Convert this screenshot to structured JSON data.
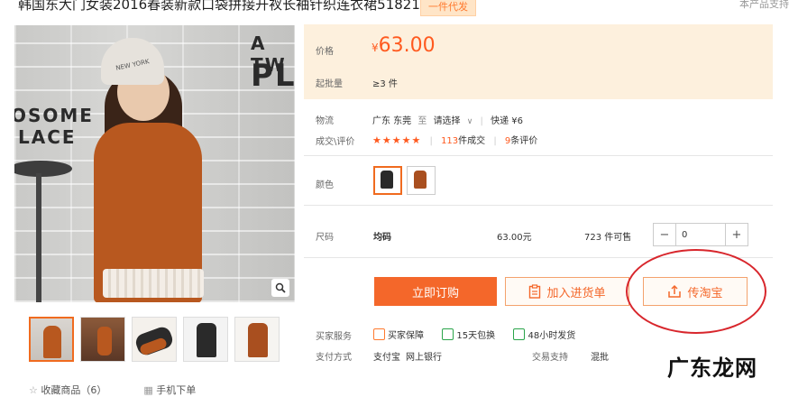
{
  "header": {
    "title": "韩国东大门女装2016春装新款口袋拼接开衩长袖针织连衣裙51821",
    "badge": "一件代发",
    "right_note": "本产品支持"
  },
  "gallery": {
    "wall_text_1": "A TW",
    "wall_text_2": "PL",
    "wall_text_3": "OSOME",
    "wall_text_4": "LACE",
    "hat_text": "NEW YORK",
    "zoom_icon": "magnifier-icon",
    "thumbnails": [
      "orange-dress",
      "orange-dress-room",
      "black-sweater",
      "black-dress",
      "orange-top"
    ]
  },
  "price_panel": {
    "price_label": "价格",
    "currency": "¥",
    "price": "63.00",
    "moq_label": "起批量",
    "moq_value": "≥3 件"
  },
  "logistics": {
    "label": "物流",
    "origin": "广东 东莞",
    "to": "至",
    "select": "请选择",
    "sep": "|",
    "express": "快递 ¥6"
  },
  "reviews": {
    "label": "成交\\评价",
    "stars": "★★★★★",
    "sep": "|",
    "deals_count": "113",
    "deals_text": "件成交",
    "review_count": "9",
    "review_text": "条评价"
  },
  "color": {
    "label": "颜色",
    "options": [
      "black",
      "orange"
    ]
  },
  "size": {
    "label": "尺码",
    "value": "均码",
    "price": "63.00元",
    "stock": "723 件可售",
    "qty": "0"
  },
  "actions": {
    "order": "立即订购",
    "add_list": "加入进货单",
    "taobao": "传淘宝"
  },
  "services": {
    "label": "买家服务",
    "items": [
      "买家保障",
      "15天包换",
      "48小时发货"
    ]
  },
  "payment": {
    "label": "支付方式",
    "methods": [
      "支付宝",
      "网上银行"
    ],
    "trade_label": "交易支持",
    "trade_value": "混批"
  },
  "bottom": {
    "fav": "收藏商品（6）",
    "mobile": "手机下单"
  },
  "watermark": "广东龙网",
  "colors": {
    "accent": "#f4672a",
    "price_bg": "#fdf0dd",
    "annotation": "#d8262c"
  }
}
